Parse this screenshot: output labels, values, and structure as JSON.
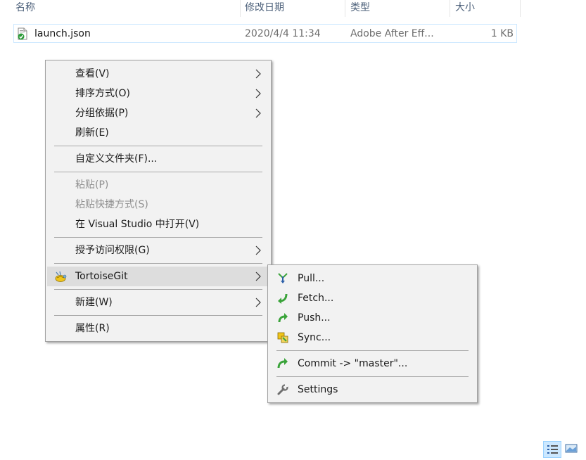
{
  "columns": {
    "name": "名称",
    "modified": "修改日期",
    "type": "类型",
    "size": "大小"
  },
  "file": {
    "name": "launch.json",
    "modified": "2020/4/4 11:34",
    "type": "Adobe After Eff...",
    "size": "1 KB",
    "icon": "json-file-icon"
  },
  "context_menu": {
    "items": [
      {
        "label": "查看(V)",
        "submenu": true
      },
      {
        "label": "排序方式(O)",
        "submenu": true
      },
      {
        "label": "分组依据(P)",
        "submenu": true
      },
      {
        "label": "刷新(E)"
      },
      {
        "label": "自定义文件夹(F)..."
      },
      {
        "label": "粘贴(P)",
        "disabled": true
      },
      {
        "label": "粘贴快捷方式(S)",
        "disabled": true
      },
      {
        "label": "在 Visual Studio 中打开(V)"
      },
      {
        "label": "授予访问权限(G)",
        "submenu": true
      },
      {
        "label": "TortoiseGit",
        "submenu": true,
        "highlighted": true,
        "icon": "tortoisegit-icon"
      },
      {
        "label": "新建(W)",
        "submenu": true
      },
      {
        "label": "属性(R)"
      }
    ]
  },
  "tortoise_submenu": {
    "items": [
      {
        "label": "Pull...",
        "icon": "pull-icon"
      },
      {
        "label": "Fetch...",
        "icon": "fetch-icon"
      },
      {
        "label": "Push...",
        "icon": "push-icon"
      },
      {
        "label": "Sync...",
        "icon": "sync-icon"
      },
      {
        "label": "Commit -> \"master\"...",
        "icon": "commit-icon"
      },
      {
        "label": "Settings",
        "icon": "wrench-icon"
      }
    ]
  },
  "colors": {
    "menu_bg": "#f2f2f2",
    "highlight": "#dddddd",
    "header_text": "#4c607a",
    "selection_border": "#cde8ff"
  }
}
